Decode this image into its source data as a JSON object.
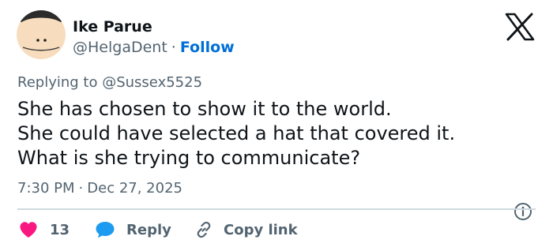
{
  "tweet": {
    "author": {
      "display_name": "Ike Parue",
      "handle": "@HelgaDent",
      "separator": "·",
      "follow_label": "Follow"
    },
    "replying_to": {
      "prefix": "Replying to",
      "mention": "@Sussex5525"
    },
    "text_lines": [
      "She has chosen to show it to the world.",
      "She could have selected a hat that covered it.",
      "What is she trying to communicate?"
    ],
    "time": "7:30 PM",
    "time_separator": "·",
    "date": "Dec 27, 2025",
    "actions": {
      "like_count": "13",
      "reply_label": "Reply",
      "copy_link_label": "Copy link"
    }
  },
  "icons": {
    "platform_logo": "x-logo-icon",
    "info": "info-icon",
    "like": "heart-icon",
    "reply": "speech-bubble-icon",
    "copy_link": "link-icon"
  },
  "colors": {
    "text_primary": "#0f1419",
    "text_secondary": "#536471",
    "link_blue": "#006fd6",
    "like_pink": "#f91880",
    "reply_blue": "#1d9bf0",
    "divider": "#cfd9de"
  }
}
